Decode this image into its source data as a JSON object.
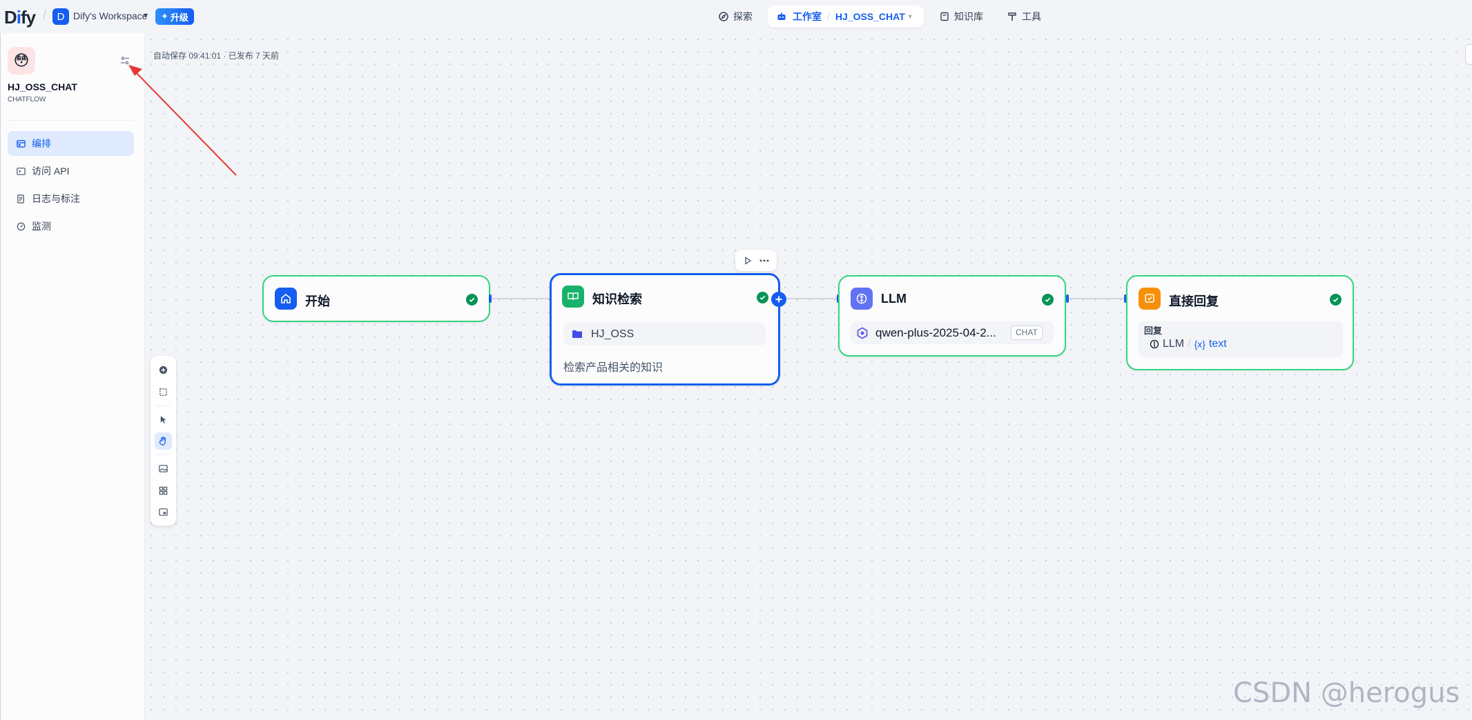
{
  "topbar": {
    "logo": {
      "pre": "D",
      "mid": "i",
      "post": "fy"
    },
    "workspace_initial": "D",
    "workspace_name": "Dify's Workspace",
    "upgrade_label": "升级",
    "nav": {
      "explore": "探索",
      "studio": "工作室",
      "app_switcher": "HJ_OSS_CHAT",
      "knowledge": "知识库",
      "tools": "工具"
    }
  },
  "sidebar": {
    "app_name": "HJ_OSS_CHAT",
    "app_type": "CHATFLOW",
    "items": [
      {
        "label": "编排",
        "icon": "layout-icon",
        "active": true
      },
      {
        "label": "访问 API",
        "icon": "terminal-icon",
        "active": false
      },
      {
        "label": "日志与标注",
        "icon": "file-list-icon",
        "active": false
      },
      {
        "label": "监测",
        "icon": "dashboard-icon",
        "active": false
      }
    ]
  },
  "canvas": {
    "autosave_text": "自动保存 09:41:01 · 已发布 7 天前"
  },
  "nodes": {
    "start": {
      "title": "开始",
      "color": "#155eef"
    },
    "retrieval": {
      "title": "知识检索",
      "color": "#17b26a",
      "dataset": "HJ_OSS",
      "description": "检索产品相关的知识"
    },
    "llm": {
      "title": "LLM",
      "color": "#6172f3",
      "model": "qwen-plus-2025-04-2...",
      "mode_badge": "CHAT"
    },
    "answer": {
      "title": "直接回复",
      "color": "#f79009",
      "field_label": "回复",
      "var_node": "LLM",
      "var_sep": "/",
      "var_name": "text",
      "var_prefix": "{x}"
    }
  },
  "watermark": "CSDN @herogus",
  "colors": {
    "accent": "#155eef",
    "success": "#079455",
    "node_border": "#32d583",
    "annotation_arrow": "#e53935"
  }
}
